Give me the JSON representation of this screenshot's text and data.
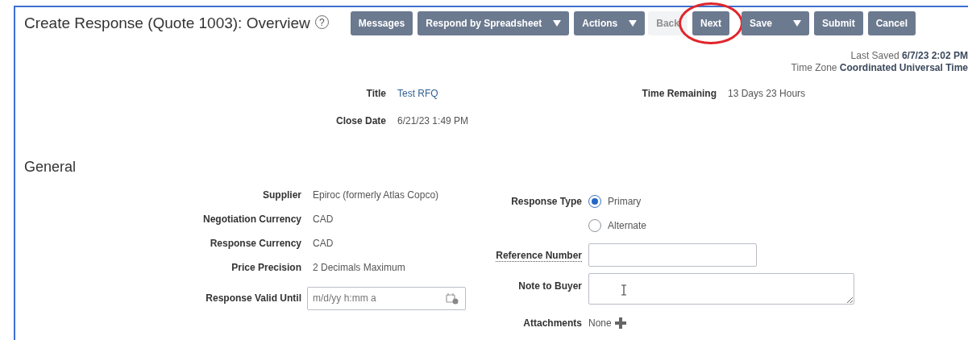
{
  "page": {
    "title": "Create Response (Quote 1003): Overview",
    "help": "?"
  },
  "toolbar": [
    {
      "label": "Messages",
      "menu": false,
      "disabled": false,
      "highlighted": false
    },
    {
      "label": "Respond by Spreadsheet",
      "menu": true,
      "disabled": false,
      "highlighted": false
    },
    {
      "label": "Actions",
      "menu": true,
      "disabled": false,
      "highlighted": false
    },
    {
      "label": "Back",
      "menu": false,
      "disabled": true,
      "highlighted": false
    },
    {
      "label": "Next",
      "menu": false,
      "disabled": false,
      "highlighted": true
    },
    {
      "label": "Save",
      "menu": true,
      "disabled": false,
      "highlighted": false
    },
    {
      "label": "Submit",
      "menu": false,
      "disabled": false,
      "highlighted": false
    },
    {
      "label": "Cancel",
      "menu": false,
      "disabled": false,
      "highlighted": false
    }
  ],
  "last_saved": {
    "label": "Last Saved",
    "value": "6/7/23 2:02 PM"
  },
  "time_zone": {
    "label": "Time Zone",
    "value": "Coordinated Universal Time"
  },
  "header_left": [
    {
      "kind": "link",
      "label": "Title",
      "value": "Test RFQ"
    },
    {
      "kind": "text",
      "label": "Close Date",
      "value": "6/21/23 1:49 PM"
    }
  ],
  "header_right": [
    {
      "kind": "text",
      "label": "Time Remaining",
      "value": "13 Days 23 Hours"
    }
  ],
  "section": "General",
  "general_left": [
    {
      "kind": "text",
      "label": "Supplier",
      "value": "Epiroc (formerly Atlas Copco)"
    },
    {
      "kind": "text",
      "label": "Negotiation Currency",
      "value": "CAD"
    },
    {
      "kind": "text",
      "label": "Response Currency",
      "value": "CAD"
    },
    {
      "kind": "text",
      "label": "Price Precision",
      "value": "2 Decimals Maximum"
    },
    {
      "kind": "date",
      "label": "Response Valid Until",
      "placeholder": "m/d/yy h:mm a"
    }
  ],
  "general_right": [
    {
      "kind": "radio",
      "label": "Response Type",
      "options": [
        {
          "label": "Primary",
          "selected": true
        },
        {
          "label": "Alternate",
          "selected": false
        }
      ]
    },
    {
      "kind": "input",
      "label": "Reference Number"
    },
    {
      "kind": "textarea",
      "label": "Note to Buyer"
    },
    {
      "kind": "attachments",
      "label": "Attachments",
      "value": "None"
    }
  ]
}
